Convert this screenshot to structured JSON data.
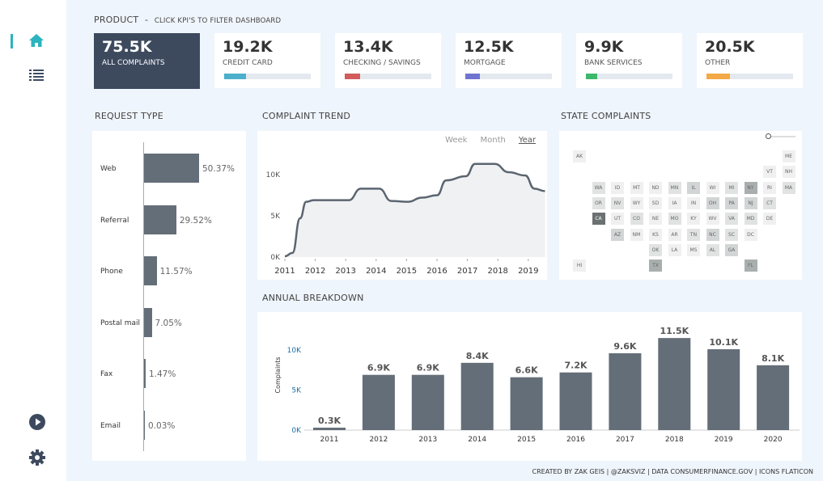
{
  "nav": {
    "items": [
      {
        "icon": "home-icon"
      },
      {
        "icon": "list-icon"
      },
      {
        "icon": "play-icon"
      },
      {
        "icon": "gear-icon"
      }
    ]
  },
  "product": {
    "title": "PRODUCT",
    "sep": "-",
    "hint": "CLICK KPI'S TO FILTER DASHBOARD"
  },
  "kpis": [
    {
      "value": "75.5K",
      "label": "ALL COMPLAINTS",
      "selected": true
    },
    {
      "value": "19.2K",
      "label": "CREDIT CARD",
      "color": "#4bb0cb",
      "share": 0.25
    },
    {
      "value": "13.4K",
      "label": "CHECKING / SAVINGS",
      "color": "#d35b5b",
      "share": 0.18
    },
    {
      "value": "12.5K",
      "label": "MORTGAGE",
      "color": "#6f74d0",
      "share": 0.17
    },
    {
      "value": "9.9K",
      "label": "BANK SERVICES",
      "color": "#3bb86a",
      "share": 0.13
    },
    {
      "value": "20.5K",
      "label": "OTHER",
      "color": "#f3a945",
      "share": 0.27
    }
  ],
  "request": {
    "title": "REQUEST TYPE",
    "items": [
      {
        "label": "Web",
        "value": 50.37,
        "text": "50.37%"
      },
      {
        "label": "Referral",
        "value": 29.52,
        "text": "29.52%"
      },
      {
        "label": "Phone",
        "value": 11.57,
        "text": "11.57%"
      },
      {
        "label": "Postal mail",
        "value": 7.05,
        "text": "7.05%"
      },
      {
        "label": "Fax",
        "value": 1.47,
        "text": "1.47%"
      },
      {
        "label": "Email",
        "value": 0.03,
        "text": "0.03%"
      }
    ]
  },
  "trend": {
    "title": "COMPLAINT TREND",
    "toggles": [
      "Week",
      "Month",
      "Year"
    ],
    "active": "Year"
  },
  "chart_data": [
    {
      "type": "area",
      "title": "COMPLAINT TREND",
      "ylim": [
        0,
        12000
      ],
      "yticks": [
        "0K",
        "5K",
        "10K"
      ],
      "xticks": [
        "2011",
        "2012",
        "2013",
        "2014",
        "2015",
        "2016",
        "2017",
        "2018",
        "2019"
      ],
      "x": [
        2011,
        2011.25,
        2011.5,
        2011.7,
        2011.95,
        2013.1,
        2013.5,
        2014.1,
        2014.5,
        2015.05,
        2015.5,
        2016,
        2016.3,
        2016.95,
        2017.25,
        2017.9,
        2018.35,
        2018.9,
        2019.2,
        2019.55
      ],
      "y": [
        100,
        500,
        4700,
        6700,
        6900,
        6900,
        8300,
        8300,
        6800,
        6700,
        7200,
        7500,
        9300,
        9800,
        11300,
        11300,
        10300,
        9900,
        8300,
        8000
      ]
    },
    {
      "type": "bar",
      "title": "ANNUAL BREAKDOWN",
      "ylabel": "Complaints",
      "ylim": [
        0,
        12500
      ],
      "yticks": [
        "0K",
        "5K",
        "10K"
      ],
      "categories": [
        "2011",
        "2012",
        "2013",
        "2014",
        "2015",
        "2016",
        "2017",
        "2018",
        "2019",
        "2020"
      ],
      "values": [
        300,
        6900,
        6900,
        8400,
        6600,
        7200,
        9600,
        11500,
        10100,
        8100
      ],
      "labels": [
        "0.3K",
        "6.9K",
        "6.9K",
        "8.4K",
        "6.6K",
        "7.2K",
        "9.6K",
        "11.5K",
        "10.1K",
        "8.1K"
      ]
    }
  ],
  "states": {
    "title": "STATE COMPLAINTS",
    "tiles": [
      [
        "AK",
        0,
        0,
        0
      ],
      [
        "ME",
        11,
        0,
        0
      ],
      [
        "VT",
        10,
        1,
        0
      ],
      [
        "NH",
        11,
        1,
        0
      ],
      [
        "WA",
        1,
        2,
        1
      ],
      [
        "ID",
        2,
        2,
        0
      ],
      [
        "MT",
        3,
        2,
        0
      ],
      [
        "ND",
        4,
        2,
        0
      ],
      [
        "MN",
        5,
        2,
        1
      ],
      [
        "IL",
        6,
        2,
        2
      ],
      [
        "WI",
        7,
        2,
        0
      ],
      [
        "MI",
        8,
        2,
        1
      ],
      [
        "NY",
        9,
        2,
        3
      ],
      [
        "RI",
        10,
        2,
        0
      ],
      [
        "MA",
        11,
        2,
        1
      ],
      [
        "OR",
        1,
        3,
        1
      ],
      [
        "NV",
        2,
        3,
        1
      ],
      [
        "WY",
        3,
        3,
        0
      ],
      [
        "SD",
        4,
        3,
        0
      ],
      [
        "IA",
        5,
        3,
        0
      ],
      [
        "IN",
        6,
        3,
        0
      ],
      [
        "OH",
        7,
        3,
        2
      ],
      [
        "PA",
        8,
        3,
        2
      ],
      [
        "NJ",
        9,
        3,
        2
      ],
      [
        "CT",
        10,
        3,
        1
      ],
      [
        "CA",
        1,
        4,
        4
      ],
      [
        "UT",
        2,
        4,
        0
      ],
      [
        "CO",
        3,
        4,
        1
      ],
      [
        "NE",
        4,
        4,
        0
      ],
      [
        "MO",
        5,
        4,
        1
      ],
      [
        "KY",
        6,
        4,
        0
      ],
      [
        "WV",
        7,
        4,
        0
      ],
      [
        "VA",
        8,
        4,
        1
      ],
      [
        "MD",
        9,
        4,
        1
      ],
      [
        "DE",
        10,
        4,
        0
      ],
      [
        "AZ",
        2,
        5,
        2
      ],
      [
        "NM",
        3,
        5,
        0
      ],
      [
        "KS",
        4,
        5,
        0
      ],
      [
        "AR",
        5,
        5,
        0
      ],
      [
        "TN",
        6,
        5,
        1
      ],
      [
        "NC",
        7,
        5,
        2
      ],
      [
        "SC",
        8,
        5,
        1
      ],
      [
        "DC",
        9,
        5,
        0
      ],
      [
        "OK",
        4,
        6,
        1
      ],
      [
        "LA",
        5,
        6,
        0
      ],
      [
        "MS",
        6,
        6,
        0
      ],
      [
        "AL",
        7,
        6,
        1
      ],
      [
        "GA",
        8,
        6,
        2
      ],
      [
        "HI",
        0,
        7,
        0
      ],
      [
        "TX",
        4,
        7,
        3
      ],
      [
        "FL",
        9,
        7,
        3
      ]
    ]
  },
  "annual": {
    "title": "ANNUAL BREAKDOWN"
  },
  "footer": "CREATED BY ZAK GEIS  |  @ZAKSVIZ  |  DATA CONSUMERFINANCE.GOV  |  ICONS FLATICON"
}
